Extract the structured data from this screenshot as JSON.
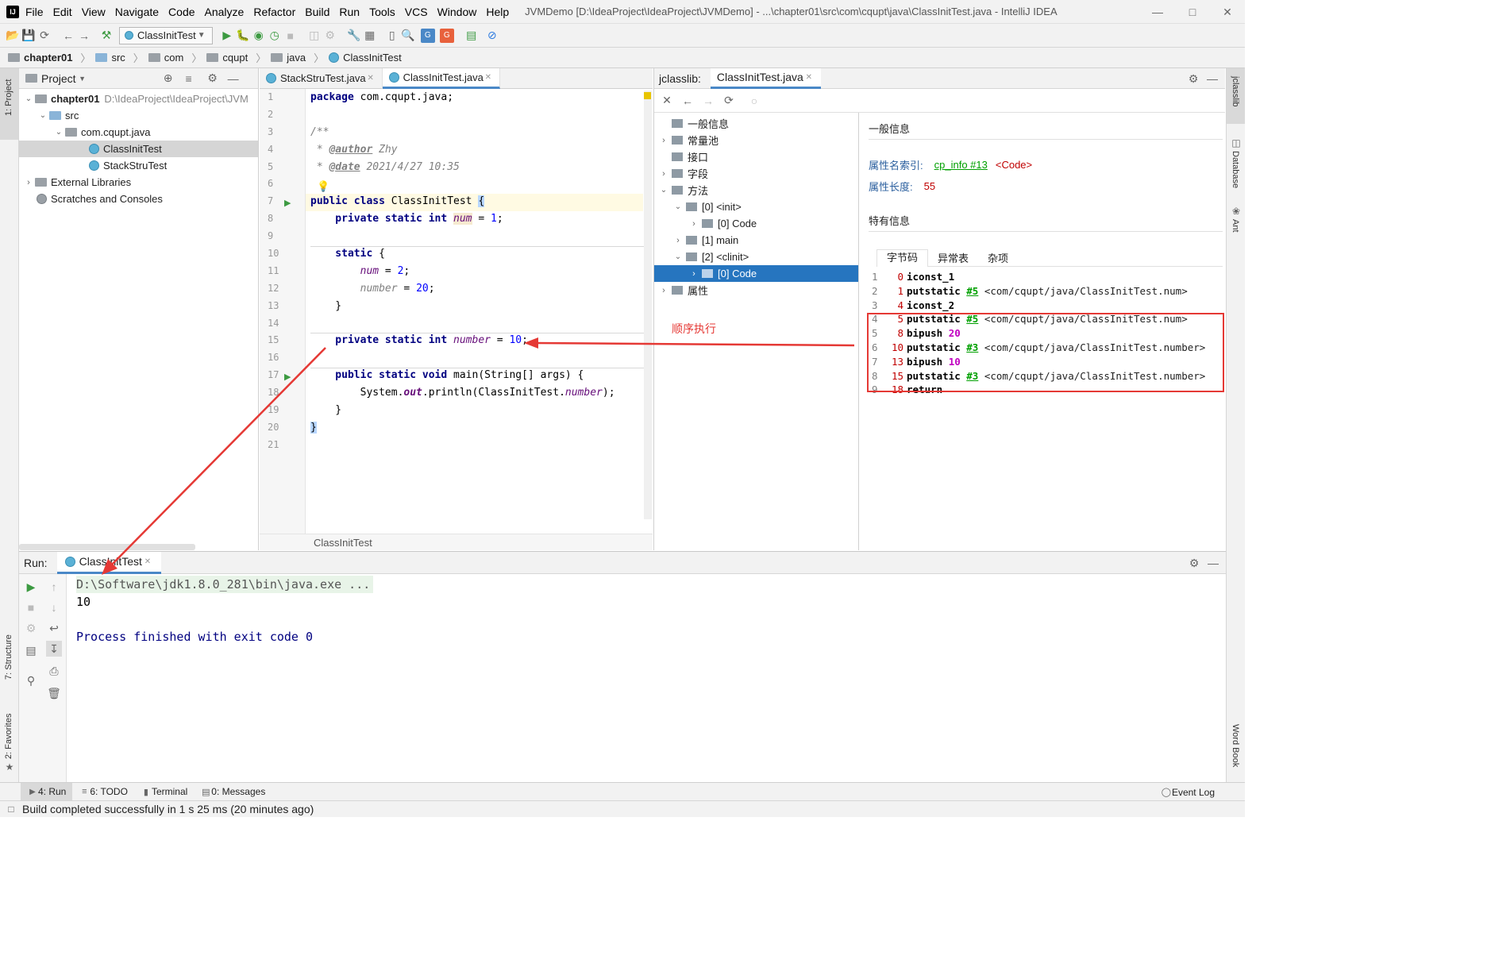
{
  "window": {
    "title": "JVMDemo [D:\\IdeaProject\\IdeaProject\\JVMDemo] - ...\\chapter01\\src\\com\\cqupt\\java\\ClassInitTest.java - IntelliJ IDEA",
    "menu": [
      "File",
      "Edit",
      "View",
      "Navigate",
      "Code",
      "Analyze",
      "Refactor",
      "Build",
      "Run",
      "Tools",
      "VCS",
      "Window",
      "Help"
    ]
  },
  "toolbar": {
    "run_config": "ClassInitTest"
  },
  "breadcrumb": [
    "chapter01",
    "src",
    "com",
    "cqupt",
    "java",
    "ClassInitTest"
  ],
  "left_strip": {
    "project_tab": "1: Project",
    "structure_tab": "7: Structure",
    "favorites_tab": "2: Favorites"
  },
  "right_strip": {
    "jclasslib_tab": "jclasslib",
    "database_tab": "Database",
    "ant_tab": "Ant",
    "wordbook_tab": "Word Book"
  },
  "project": {
    "header": "Project",
    "tree": [
      {
        "label": "chapter01",
        "path": "D:\\IdeaProject\\IdeaProject\\JVM"
      },
      {
        "label": "src"
      },
      {
        "label": "com.cqupt.java"
      },
      {
        "label": "ClassInitTest"
      },
      {
        "label": "StackStruTest"
      },
      {
        "label": "External Libraries"
      },
      {
        "label": "Scratches and Consoles"
      }
    ]
  },
  "editor": {
    "tabs": [
      "StackStruTest.java",
      "ClassInitTest.java"
    ],
    "line_numbers": [
      "1",
      "2",
      "3",
      "4",
      "5",
      "6",
      "7",
      "8",
      "9",
      "10",
      "11",
      "12",
      "13",
      "14",
      "15",
      "16",
      "17",
      "18",
      "19",
      "20",
      "21"
    ],
    "footer": "ClassInitTest",
    "code": {
      "l1_kw": "package",
      "l1_rest": " com.cqupt.java;",
      "l3": "/**",
      "l4_pre": " * ",
      "l4_tag": "@author",
      "l4_rest": " Zhy",
      "l5_pre": " * ",
      "l5_tag": "@date",
      "l5_rest": " 2021/4/27 10:35",
      "l7_kw": "public class",
      "l7_rest": " ClassInitTest ",
      "l7_brace": "{",
      "l8_kw": "    private static int ",
      "l8_field": "num",
      "l8_eq": " = ",
      "l8_num": "1",
      "l8_end": ";",
      "l10_kw": "    static",
      "l10_rest": " {",
      "l11_pre": "        ",
      "l11_field": "num",
      "l11_eq": " = ",
      "l11_num": "2",
      "l11_end": ";",
      "l12_pre": "        ",
      "l12_field": "number",
      "l12_eq": " = ",
      "l12_num": "20",
      "l12_end": ";",
      "l13": "    }",
      "l15_kw": "    private static int ",
      "l15_field": "number",
      "l15_eq": " = ",
      "l15_num": "10",
      "l15_end": ";",
      "l17_kw": "    public static void",
      "l17_rest": " main(String[] args) {",
      "l18_pre": "        System.",
      "l18_out": "out",
      "l18_mid": ".println(ClassInitTest.",
      "l18_field": "number",
      "l18_end": ");",
      "l19": "    }",
      "l20": "}"
    }
  },
  "jclasslib": {
    "label": "jclasslib:",
    "tab": "ClassInitTest.java",
    "tree": [
      {
        "label": "一般信息"
      },
      {
        "label": "常量池"
      },
      {
        "label": "接口"
      },
      {
        "label": "字段"
      },
      {
        "label": "方法"
      },
      {
        "label": "[0] <init>"
      },
      {
        "label": "[0] Code"
      },
      {
        "label": "[1] main"
      },
      {
        "label": "[2] <clinit>"
      },
      {
        "label": "[0] Code"
      },
      {
        "label": "属性"
      }
    ],
    "general_header": "一般信息",
    "attr_name_label": "属性名索引:",
    "attr_name_link": "cp_info #13",
    "attr_name_value": "<Code>",
    "attr_len_label": "属性长度:",
    "attr_len_value": "55",
    "specific_header": "特有信息",
    "tabs": [
      "字节码",
      "异常表",
      "杂项"
    ],
    "bytecode": [
      {
        "n": "1",
        "off": "0",
        "op": "iconst_1",
        "ref": "",
        "arg": ""
      },
      {
        "n": "2",
        "off": "1",
        "op": "putstatic",
        "ref": "#5",
        "arg": " <com/cqupt/java/ClassInitTest.num>"
      },
      {
        "n": "3",
        "off": "4",
        "op": "iconst_2",
        "ref": "",
        "arg": ""
      },
      {
        "n": "4",
        "off": "5",
        "op": "putstatic",
        "ref": "#5",
        "arg": " <com/cqupt/java/ClassInitTest.num>"
      },
      {
        "n": "5",
        "off": "8",
        "op": "bipush",
        "ref": "",
        "arg": "20"
      },
      {
        "n": "6",
        "off": "10",
        "op": "putstatic",
        "ref": "#3",
        "arg": " <com/cqupt/java/ClassInitTest.number>"
      },
      {
        "n": "7",
        "off": "13",
        "op": "bipush",
        "ref": "",
        "arg": "10"
      },
      {
        "n": "8",
        "off": "15",
        "op": "putstatic",
        "ref": "#3",
        "arg": " <com/cqupt/java/ClassInitTest.number>"
      },
      {
        "n": "9",
        "off": "18",
        "op": "return",
        "ref": "",
        "arg": ""
      }
    ]
  },
  "annotation": {
    "text": "顺序执行",
    "color": "#e53935"
  },
  "run": {
    "label": "Run:",
    "tab": "ClassInitTest",
    "output": [
      "D:\\Software\\jdk1.8.0_281\\bin\\java.exe ...",
      "10",
      "",
      "Process finished with exit code 0"
    ]
  },
  "bottom_tabs": [
    "4: Run",
    "6: TODO",
    "Terminal",
    "0: Messages"
  ],
  "event_log": "Event Log",
  "status": "Build completed successfully in 1 s 25 ms (20 minutes ago)",
  "colors": {
    "accent": "#4a88c7",
    "selection": "#2675bf",
    "highlight_box": "#e53935",
    "run_green": "#3c9a41"
  }
}
